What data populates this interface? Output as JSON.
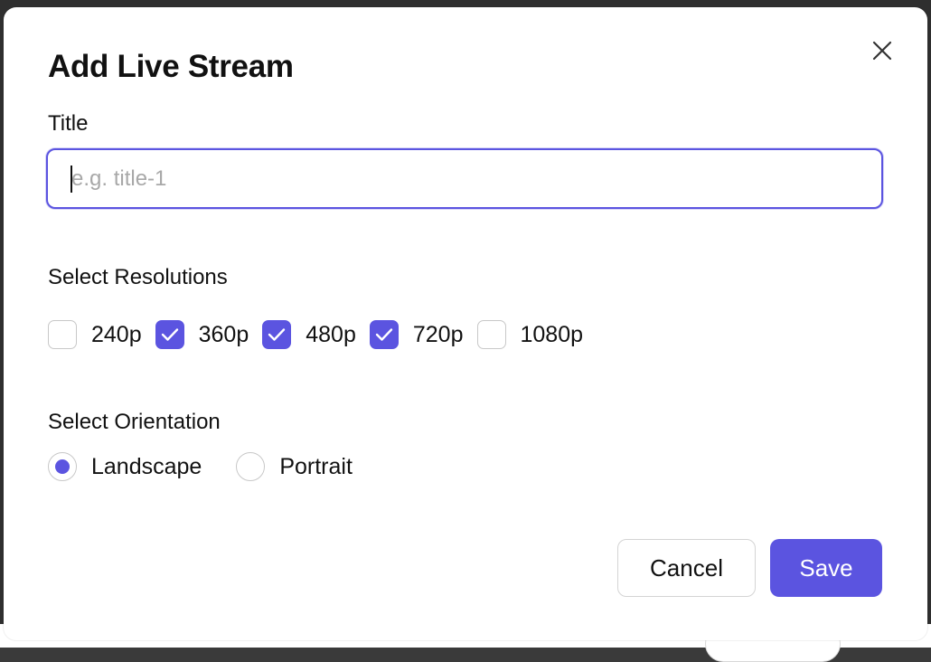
{
  "modal": {
    "title": "Add Live Stream",
    "close_icon": "close-icon"
  },
  "title_field": {
    "label": "Title",
    "value": "",
    "placeholder": "e.g. title-1"
  },
  "resolutions": {
    "label": "Select Resolutions",
    "options": [
      {
        "label": "240p",
        "checked": false
      },
      {
        "label": "360p",
        "checked": true
      },
      {
        "label": "480p",
        "checked": true
      },
      {
        "label": "720p",
        "checked": true
      },
      {
        "label": "1080p",
        "checked": false
      }
    ]
  },
  "orientation": {
    "label": "Select Orientation",
    "options": [
      {
        "label": "Landscape",
        "selected": true
      },
      {
        "label": "Portrait",
        "selected": false
      }
    ]
  },
  "actions": {
    "cancel_label": "Cancel",
    "save_label": "Save"
  },
  "colors": {
    "accent": "#5b54e0",
    "border": "#c8c8c8",
    "text": "#111111"
  }
}
